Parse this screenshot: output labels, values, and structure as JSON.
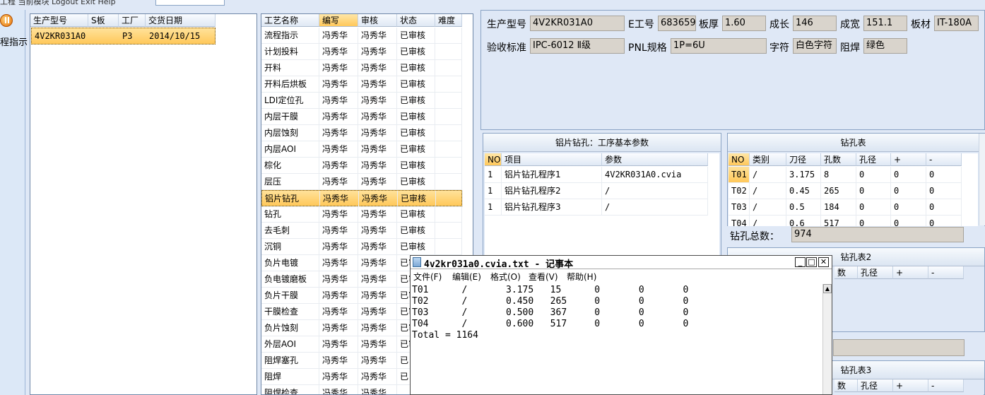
{
  "topbar": {
    "menu_text": "工程  当前模块  Logout  Exit  Help"
  },
  "toolstrip": {
    "guide_label": "程指示"
  },
  "order_grid": {
    "columns": [
      "生产型号",
      "S板",
      "工厂",
      "交货日期"
    ],
    "rows": [
      {
        "model": "4V2KR031A0",
        "sboard": "",
        "factory": "P3",
        "date": "2014/10/15"
      }
    ]
  },
  "process_grid": {
    "columns": [
      "工艺名称",
      "编写",
      "审核",
      "状态",
      "难度"
    ],
    "rows": [
      {
        "name": "流程指示",
        "writer": "冯秀华",
        "reviewer": "冯秀华",
        "status": "已审核"
      },
      {
        "name": "计划投料",
        "writer": "冯秀华",
        "reviewer": "冯秀华",
        "status": "已审核"
      },
      {
        "name": "开料",
        "writer": "冯秀华",
        "reviewer": "冯秀华",
        "status": "已审核"
      },
      {
        "name": "开料后烘板",
        "writer": "冯秀华",
        "reviewer": "冯秀华",
        "status": "已审核"
      },
      {
        "name": "LDI定位孔",
        "writer": "冯秀华",
        "reviewer": "冯秀华",
        "status": "已审核"
      },
      {
        "name": "内层干膜",
        "writer": "冯秀华",
        "reviewer": "冯秀华",
        "status": "已审核"
      },
      {
        "name": "内层蚀刻",
        "writer": "冯秀华",
        "reviewer": "冯秀华",
        "status": "已审核"
      },
      {
        "name": "内层AOI",
        "writer": "冯秀华",
        "reviewer": "冯秀华",
        "status": "已审核"
      },
      {
        "name": "棕化",
        "writer": "冯秀华",
        "reviewer": "冯秀华",
        "status": "已审核"
      },
      {
        "name": "层压",
        "writer": "冯秀华",
        "reviewer": "冯秀华",
        "status": "已审核"
      },
      {
        "name": "铝片钻孔",
        "writer": "冯秀华",
        "reviewer": "冯秀华",
        "status": "已审核"
      },
      {
        "name": "钻孔",
        "writer": "冯秀华",
        "reviewer": "冯秀华",
        "status": "已审核"
      },
      {
        "name": "去毛刺",
        "writer": "冯秀华",
        "reviewer": "冯秀华",
        "status": "已审核"
      },
      {
        "name": "沉铜",
        "writer": "冯秀华",
        "reviewer": "冯秀华",
        "status": "已审核"
      },
      {
        "name": "负片电镀",
        "writer": "冯秀华",
        "reviewer": "冯秀华",
        "status": "已审核"
      },
      {
        "name": "负电镀磨板",
        "writer": "冯秀华",
        "reviewer": "冯秀华",
        "status": "已审核"
      },
      {
        "name": "负片干膜",
        "writer": "冯秀华",
        "reviewer": "冯秀华",
        "status": "已审核"
      },
      {
        "name": "干膜检查",
        "writer": "冯秀华",
        "reviewer": "冯秀华",
        "status": "已审核"
      },
      {
        "name": "负片蚀刻",
        "writer": "冯秀华",
        "reviewer": "冯秀华",
        "status": "已审核"
      },
      {
        "name": "外层AOI",
        "writer": "冯秀华",
        "reviewer": "冯秀华",
        "status": "已审核"
      },
      {
        "name": "阻焊塞孔",
        "writer": "冯秀华",
        "reviewer": "冯秀华",
        "status": "已"
      },
      {
        "name": "阻焊",
        "writer": "冯秀华",
        "reviewer": "冯秀华",
        "status": "已"
      },
      {
        "name": "阻焊检查",
        "writer": "冯秀华",
        "reviewer": "冯秀华",
        "status": ""
      }
    ]
  },
  "info": {
    "model_label": "生产型号",
    "model_value": "4V2KR031A0",
    "eno_label": "E工号",
    "eno_value": "683659",
    "thick_label": "板厚",
    "thick_value": "1.60",
    "len_label": "成长",
    "len_value": "146",
    "width_label": "成宽",
    "width_value": "151.1",
    "material_label": "板材",
    "material_value": "IT-180A",
    "std_label": "验收标准",
    "std_value": "IPC-6012 Ⅱ级",
    "pnl_label": "PNL规格",
    "pnl_value": "1P=6U",
    "char_label": "字符",
    "char_value": "白色字符",
    "mask_label": "阻焊",
    "mask_value": "绿色"
  },
  "param_panel": {
    "title": "铝片钻孔：工序基本参数",
    "columns": [
      "NO",
      "项目",
      "参数"
    ],
    "rows": [
      {
        "no": "1",
        "item": "铝片钻孔程序1",
        "param": "4V2KR031A0.cvia"
      },
      {
        "no": "1",
        "item": "铝片钻孔程序2",
        "param": "/"
      },
      {
        "no": "1",
        "item": "铝片钻孔程序3",
        "param": "/"
      }
    ]
  },
  "drill_panel": {
    "title": "钻孔表",
    "columns": [
      "NO",
      "类别",
      "刀径",
      "孔数",
      "孔径",
      "+",
      "-"
    ],
    "rows": [
      {
        "no": "T01",
        "type": "/",
        "dia": "3.175",
        "count": "8",
        "hole": "0",
        "plus": "0",
        "minus": "0"
      },
      {
        "no": "T02",
        "type": "/",
        "dia": "0.45",
        "count": "265",
        "hole": "0",
        "plus": "0",
        "minus": "0"
      },
      {
        "no": "T03",
        "type": "/",
        "dia": "0.5",
        "count": "184",
        "hole": "0",
        "plus": "0",
        "minus": "0"
      },
      {
        "no": "T04",
        "type": "/",
        "dia": "0.6",
        "count": "517",
        "hole": "0",
        "plus": "0",
        "minus": "0"
      }
    ],
    "total_label": "钻孔总数：",
    "total_value": "974"
  },
  "drill2_panel": {
    "title": "钻孔表2",
    "columns": [
      "数",
      "孔径",
      "+",
      "-"
    ]
  },
  "drill3_panel": {
    "title": "钻孔表3",
    "columns": [
      "数",
      "孔径",
      "+",
      "-"
    ]
  },
  "notepad": {
    "title": "4v2kr031a0.cvia.txt - 记事本",
    "menu": [
      "文件(F)",
      "编辑(E)",
      "格式(O)",
      "查看(V)",
      "帮助(H)"
    ],
    "content": "T01      /       3.175   15      0       0       0\nT02      /       0.450   265     0       0       0\nT03      /       0.500   367     0       0       0\nT04      /       0.600   517     0       0       0\nTotal = 1164"
  },
  "colors": {
    "selection": "#ffc85a",
    "panel_bg": "#dfe8f6",
    "field_bg": "#d9d4cc"
  }
}
